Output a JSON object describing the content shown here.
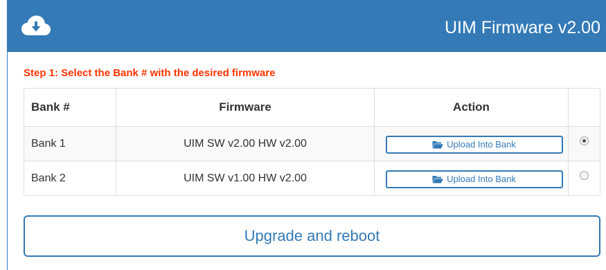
{
  "header": {
    "title": "UIM Firmware v2.00",
    "icon": "cloud-download-icon",
    "background_color": "#337ab7"
  },
  "step_text": "Step 1: Select the Bank # with the desired firmware",
  "step_color": "#ff3300",
  "table": {
    "columns": [
      "Bank #",
      "Firmware",
      "Action",
      ""
    ],
    "rows": [
      {
        "bank": "Bank 1",
        "firmware": "UIM SW v2.00 HW v2.00",
        "action_label": "Upload Into Bank",
        "action_icon": "folder-open-icon",
        "selected": true
      },
      {
        "bank": "Bank 2",
        "firmware": "UIM SW v1.00 HW v2.00",
        "action_label": "Upload Into Bank",
        "action_icon": "folder-open-icon",
        "selected": false
      }
    ]
  },
  "upgrade_button": {
    "label": "Upgrade and reboot"
  }
}
